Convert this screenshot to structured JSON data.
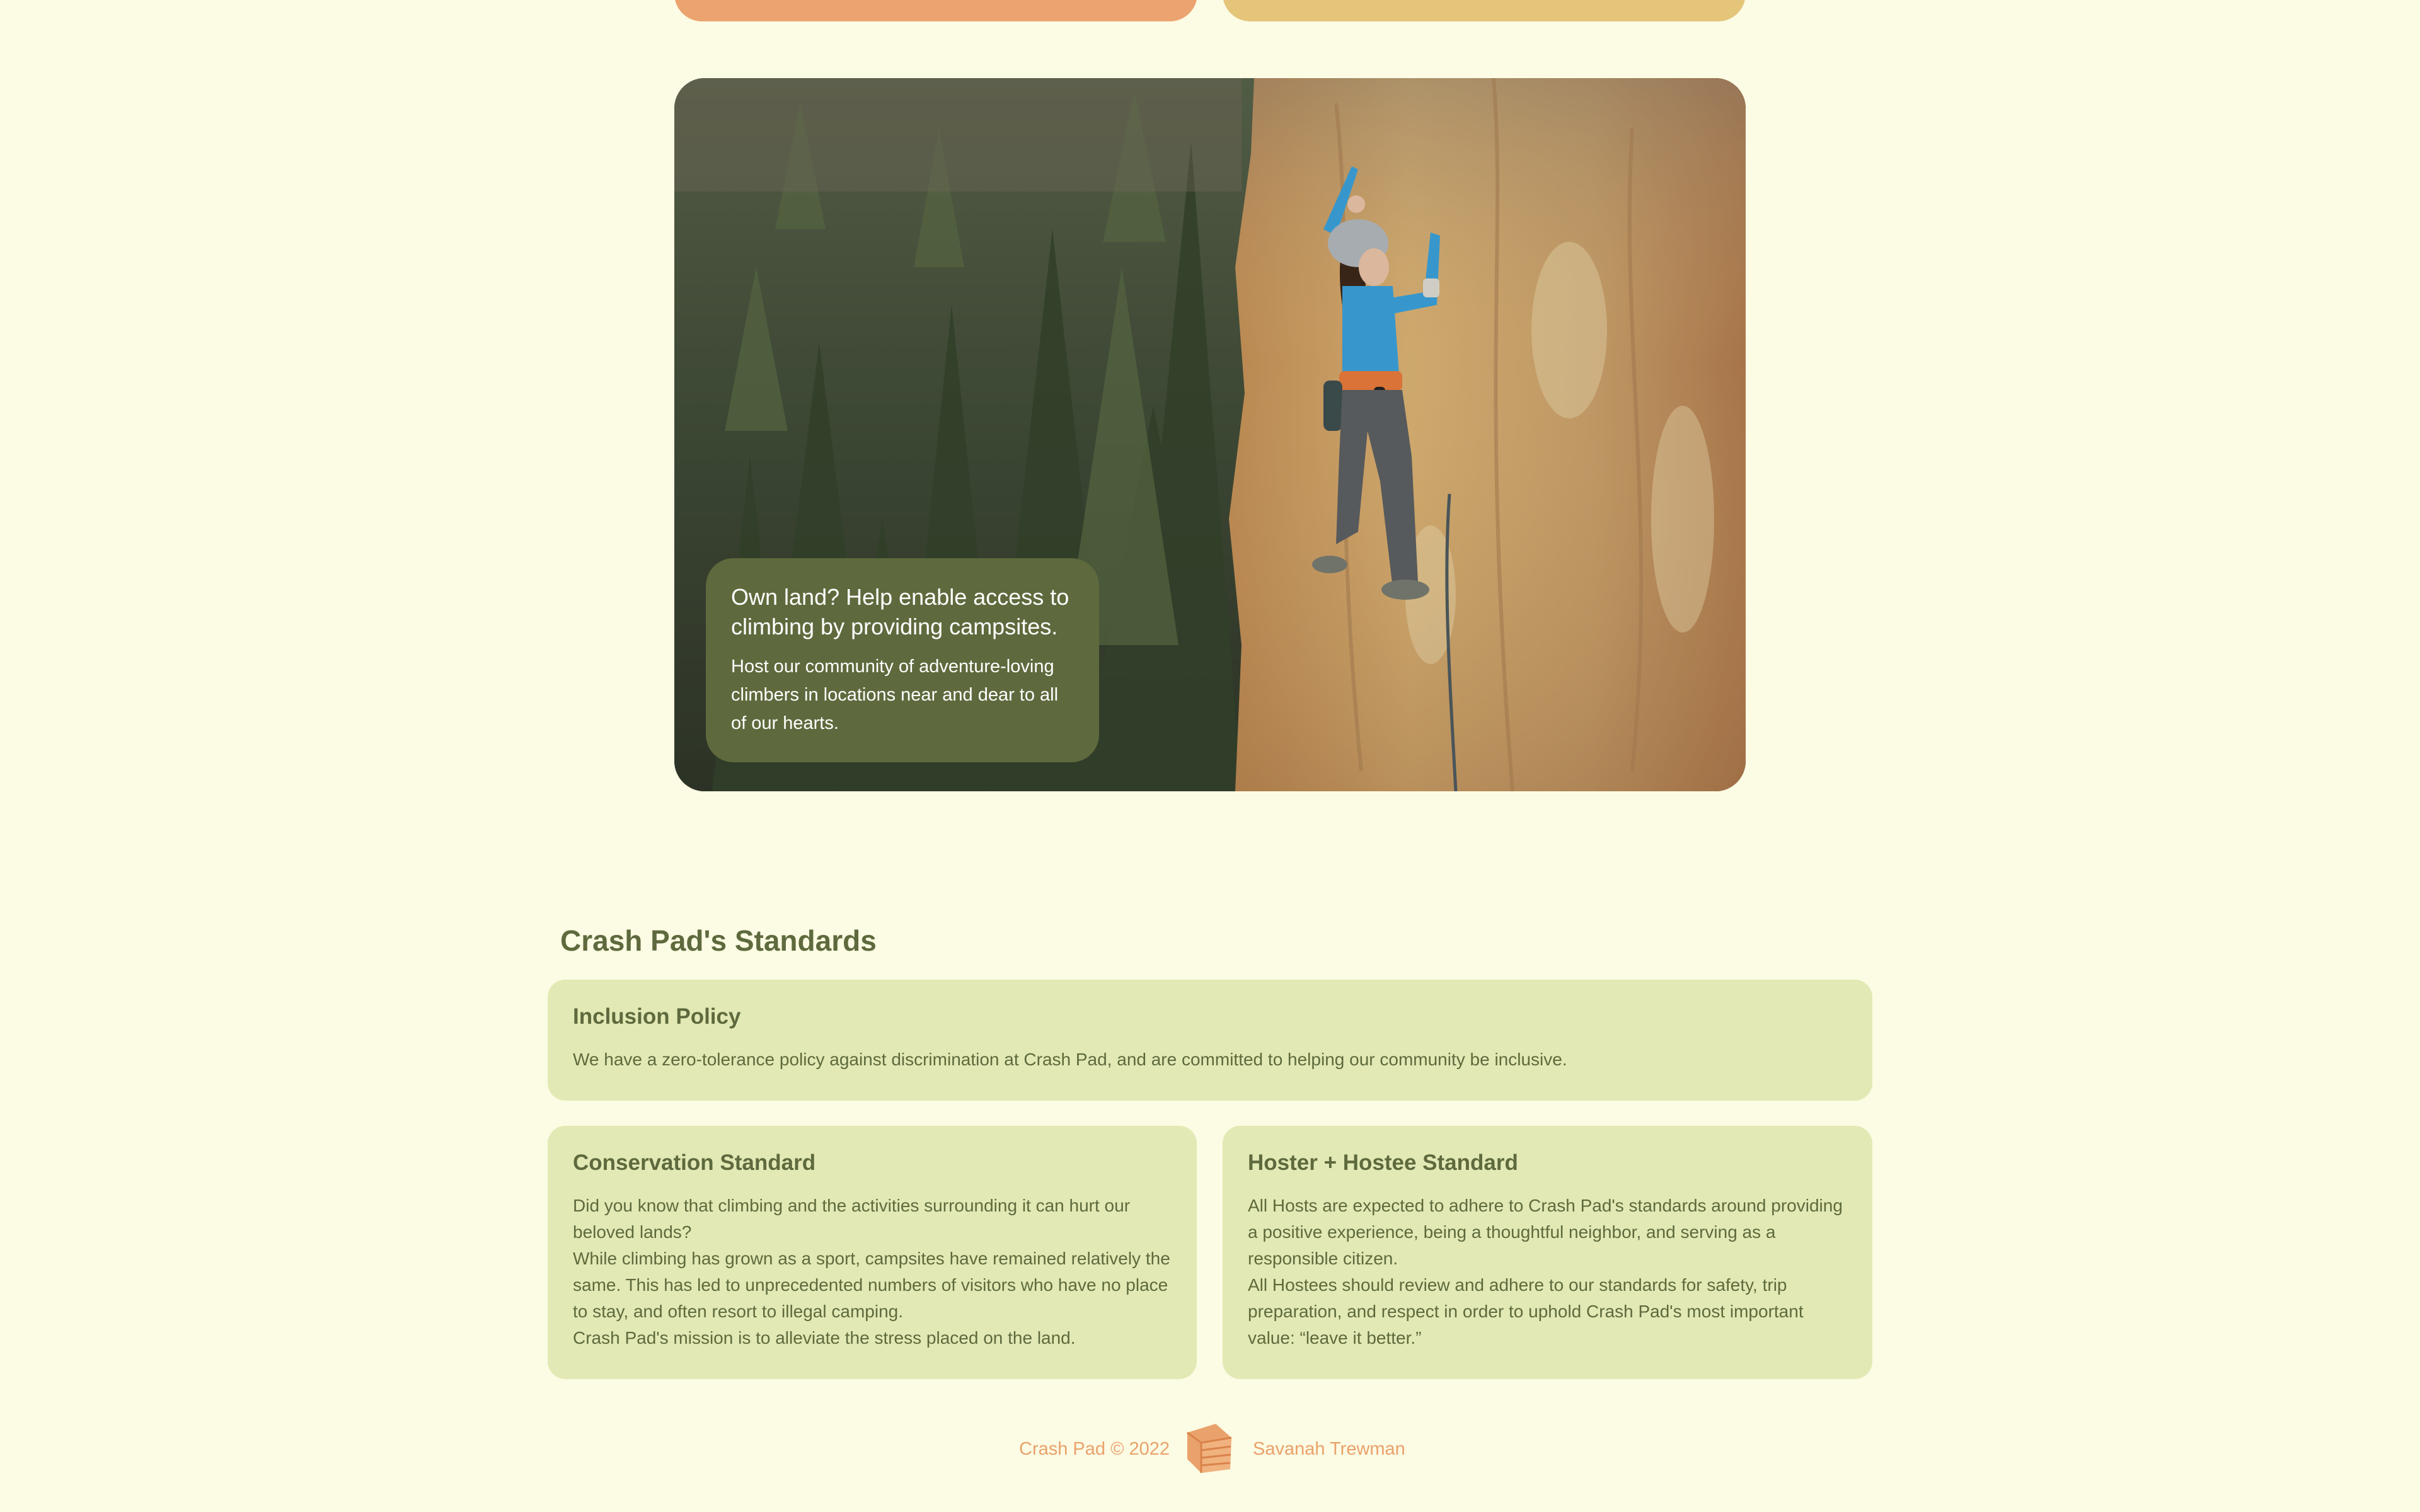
{
  "colors": {
    "page_background": "#fcfbe3",
    "olive": "#5e6a3d",
    "card_green": "#e2e9b5",
    "orange": "#eba46f",
    "yellow": "#e4c57a"
  },
  "hero": {
    "image_description": "climber-on-rock-wall-photo",
    "heading": "Own land? Help enable access to climbing by providing campsites.",
    "body": "Host our community of adventure-loving climbers in locations near and dear to all of our hearts."
  },
  "standards": {
    "title": "Crash Pad's Standards",
    "inclusion": {
      "title": "Inclusion Policy",
      "body": "We have a zero-tolerance policy against discrimination at Crash Pad, and are committed to helping our community be inclusive."
    },
    "conservation": {
      "title": "Conservation Standard",
      "lines": [
        "Did you know that climbing and the activities surrounding it can hurt our beloved lands?",
        "While climbing has grown as a sport, campsites have remained relatively the same. This has led to unprecedented numbers of visitors who have no place to stay, and often resort to illegal camping.",
        "Crash Pad's mission is to alleviate the stress placed on the land."
      ]
    },
    "hoster": {
      "title": "Hoster + Hostee Standard",
      "lines": [
        "All Hosts are expected to adhere to Crash Pad's standards around providing a positive experience, being a thoughtful neighbor, and serving as a responsible citizen.",
        "All Hostees should review and adhere to our standards for safety, trip preparation, and respect in order to uphold Crash Pad's most important value: “leave it better.”"
      ]
    }
  },
  "footer": {
    "copyright": "Crash Pad © 2022",
    "logo_icon": "crash-pad-logo-icon",
    "author": "Savanah Trewman"
  }
}
